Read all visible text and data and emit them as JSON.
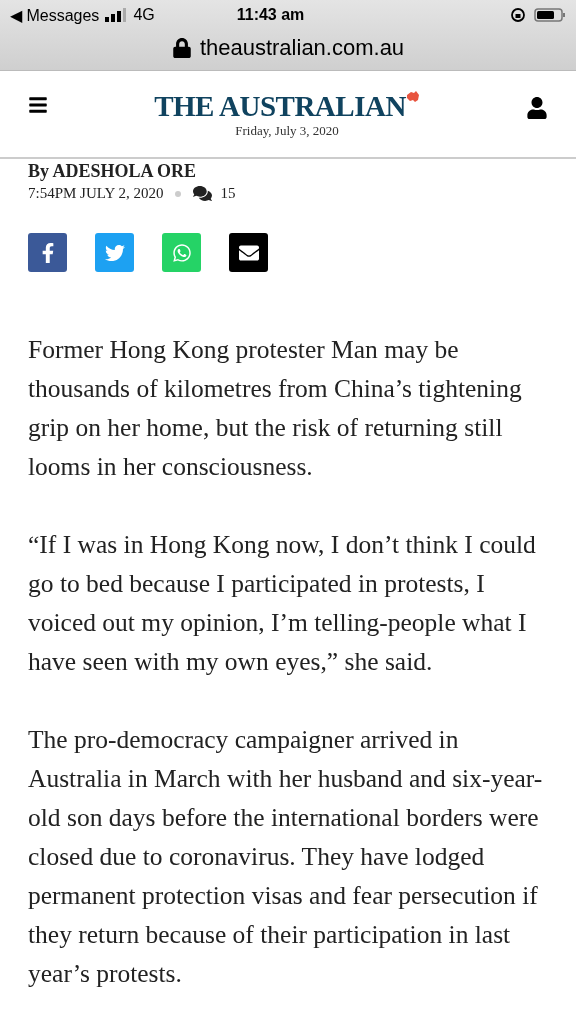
{
  "status_bar": {
    "back_label": "◀ Messages",
    "network": "4G",
    "time": "11:43 am"
  },
  "address_bar": {
    "url": "theaustralian.com.au"
  },
  "masthead": {
    "title": "THE AUSTRALIAN",
    "date": "Friday, July 3, 2020"
  },
  "article": {
    "byline": "By ADESHOLA ORE",
    "timestamp": "7:54PM JULY 2, 2020",
    "comment_count": "15",
    "share": [
      {
        "kind": "facebook",
        "color": "#3b5998"
      },
      {
        "kind": "twitter",
        "color": "#1da1f2"
      },
      {
        "kind": "whatsapp",
        "color": "#25d366"
      },
      {
        "kind": "email",
        "color": "#000000"
      }
    ],
    "paragraphs": [
      "Former Hong Kong protester Man may be thousands of kilometres from China’s tightening grip on her home, but the risk of returning still looms in her consciousness.",
      "“If I was in Hong Kong now, I don’t think I could go to bed because I participated in protests, I voiced out my opinion, I’m telling-people what I have seen with my own eyes,” she said.",
      "The pro-democracy campaigner arrived in Australia in March with her husband and six-year-old son days before the international borders were closed due to coronavirus. They have lodged permanent protection visas and fear persecution if they return because of their participation in last year’s protests."
    ]
  }
}
